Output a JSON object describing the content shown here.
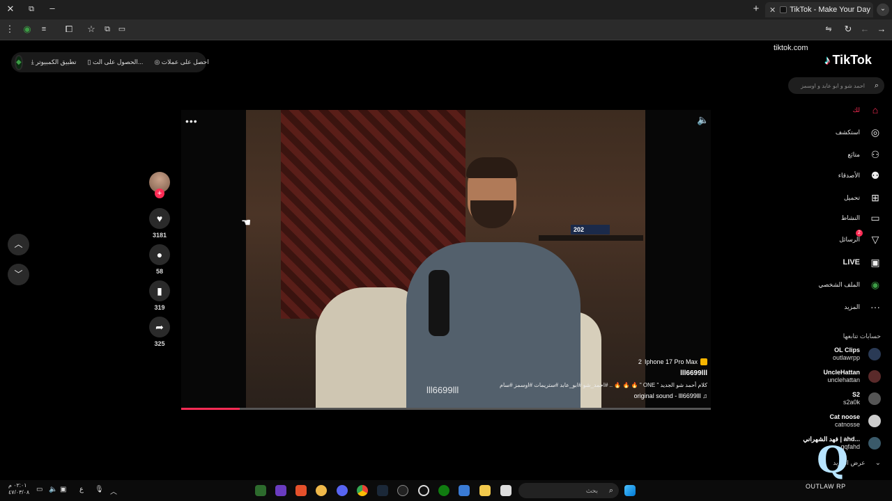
{
  "browser": {
    "tab_title": "TikTok - Make Your Day",
    "url": "tiktok.com"
  },
  "top_bar": {
    "items": [
      "تطبيق الكمبيوتر",
      "الحصول على الت...",
      "احصل على عملات"
    ]
  },
  "sidebar": {
    "brand": "TikTok",
    "search_placeholder": "احمد شو و ابو عابد و اوسمز",
    "nav": [
      {
        "label": "لك",
        "icon": "home-icon",
        "active": true
      },
      {
        "label": "استكشف",
        "icon": "compass-icon",
        "active": false
      },
      {
        "label": "متابَع",
        "icon": "user-plus-icon",
        "active": false
      },
      {
        "label": "الأصدقاء",
        "icon": "friends-icon",
        "active": false
      },
      {
        "label": "تحميل",
        "icon": "upload-icon",
        "active": false
      },
      {
        "label": "النشاط",
        "icon": "activity-icon",
        "active": false
      },
      {
        "label": "الرسائل",
        "icon": "messages-icon",
        "active": false,
        "badge": "2"
      },
      {
        "label": "LIVE",
        "icon": "live-icon",
        "active": false
      },
      {
        "label": "الملف الشخصي",
        "icon": "profile-avatar-icon",
        "active": false
      },
      {
        "label": "المزيد",
        "icon": "more-icon",
        "active": false
      }
    ],
    "following_title": "حسابات تتابعها",
    "following": [
      {
        "name": "OL Clips",
        "handle": "outlawrpp",
        "avatar_color": "#2a3a55"
      },
      {
        "name": "UncleHattan",
        "handle": "unclehattan",
        "avatar_color": "#5a2a2a"
      },
      {
        "name": "S2",
        "handle": "s2a0k",
        "avatar_color": "#555555"
      },
      {
        "name": "Cat noose",
        "handle": "catnosse",
        "avatar_color": "#cccccc"
      },
      {
        "name": "فهد الشهراني | ahd...",
        "handle": "qqfahd",
        "avatar_color": "#3a5a6a"
      }
    ],
    "see_more": "عرض المزيد"
  },
  "video": {
    "watermark": "lll6699lll",
    "progress": 0.11,
    "badge_label": "Iphone 17 Pro Max",
    "badge_count": "2",
    "author": "lll6699lll",
    "caption": "كلام أحمد شو الجديد \" ONE \" 🔥 🔥 🔥 .. #احمد_شو #ابو_عابد #ستريمات #اوسمز #سام",
    "sound": "♫ original sound - lll6699lll",
    "book_text": "202"
  },
  "actions": {
    "likes": "3181",
    "comments": "58",
    "saves": "319",
    "shares": "325"
  },
  "taskbar": {
    "search_placeholder": "بحث",
    "time": "٠٢:٠١ م",
    "date": "٤٧/٠٣/٠٨",
    "lang": "ع"
  },
  "overlay_logo": {
    "text": "OUTLAW RP"
  }
}
